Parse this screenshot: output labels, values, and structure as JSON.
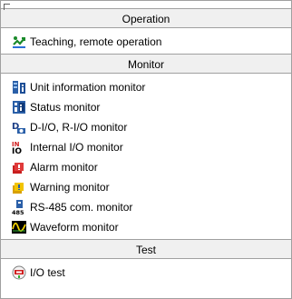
{
  "sections": [
    {
      "title": "Operation",
      "items": [
        {
          "label": "Teaching, remote operation",
          "icon": "teaching-icon"
        }
      ]
    },
    {
      "title": "Monitor",
      "items": [
        {
          "label": "Unit information monitor",
          "icon": "unit-info-icon"
        },
        {
          "label": "Status monitor",
          "icon": "status-monitor-icon"
        },
        {
          "label": "D-I/O, R-I/O monitor",
          "icon": "dio-rio-icon"
        },
        {
          "label": "Internal I/O monitor",
          "icon": "internal-io-icon"
        },
        {
          "label": "Alarm monitor",
          "icon": "alarm-icon"
        },
        {
          "label": "Warning monitor",
          "icon": "warning-icon"
        },
        {
          "label": "RS-485 com. monitor",
          "icon": "rs485-icon"
        },
        {
          "label": "Waveform monitor",
          "icon": "waveform-icon"
        }
      ]
    },
    {
      "title": "Test",
      "items": [
        {
          "label": "I/O test",
          "icon": "io-test-icon"
        }
      ]
    }
  ]
}
